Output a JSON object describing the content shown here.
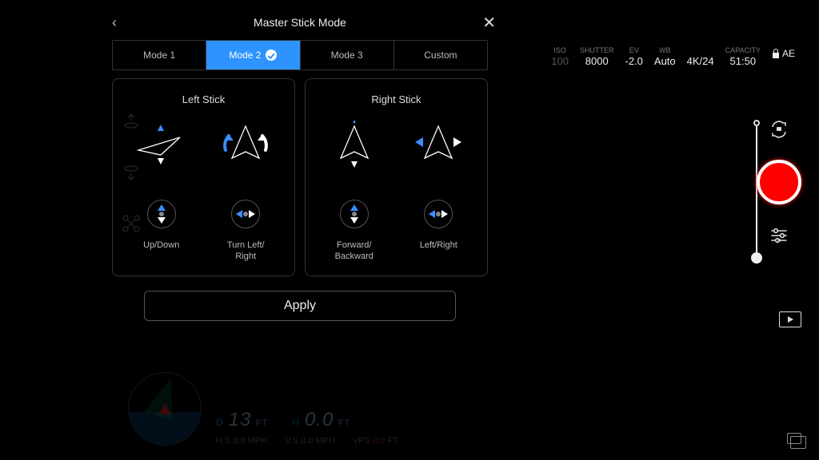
{
  "header": {
    "title": "Master Stick Mode"
  },
  "tabs": [
    "Mode 1",
    "Mode 2",
    "Mode 3",
    "Custom"
  ],
  "active_tab": 1,
  "left_stick": {
    "title": "Left Stick",
    "fn1": "Up/Down",
    "fn2": "Turn Left/\nRight"
  },
  "right_stick": {
    "title": "Right Stick",
    "fn1": "Forward/\nBackward",
    "fn2": "Left/Right"
  },
  "apply_label": "Apply",
  "telemetry": {
    "iso": {
      "label": "ISO",
      "value": "100"
    },
    "shutter": {
      "label": "SHUTTER",
      "value": "8000"
    },
    "ev": {
      "label": "EV",
      "value": "-2.0"
    },
    "wb": {
      "label": "WB",
      "value": "Auto"
    },
    "fmt": {
      "label": "",
      "value": "4K/24"
    },
    "capacity": {
      "label": "CAPACITY",
      "value": "51:50"
    },
    "ae": "AE"
  },
  "footer": {
    "d_label": "D",
    "d_val": "13",
    "d_unit": "FT",
    "h_label": "H",
    "h_val": "0.0",
    "h_unit": "FT",
    "hs_label": "H.S",
    "hs_val": "0.0",
    "hs_unit": "MPH",
    "vs_label": "V.S",
    "vs_val": "0.0",
    "vs_unit": "MPH",
    "vps_label": "VPS",
    "vps_val": "0.0",
    "vps_unit": "FT"
  }
}
